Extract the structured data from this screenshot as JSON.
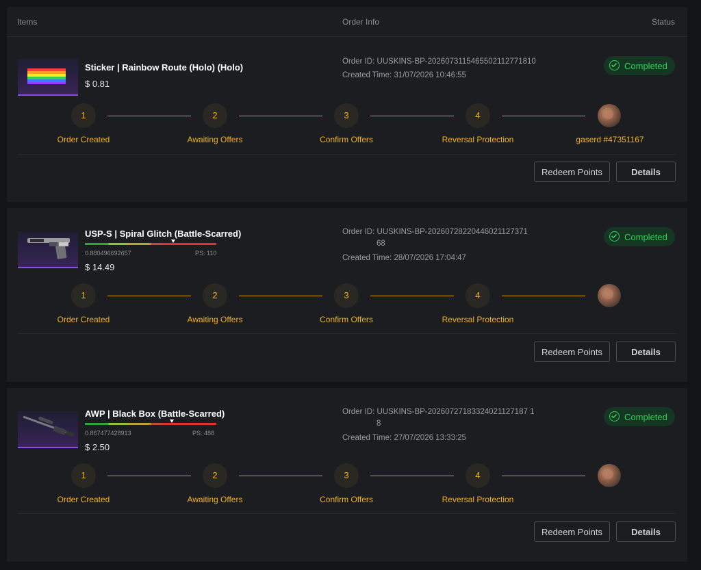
{
  "header": {
    "items": "Items",
    "order_info": "Order Info",
    "status": "Status"
  },
  "labels": {
    "order_id_prefix": "Order ID:",
    "created_prefix": "Created Time:",
    "redeem": "Redeem Points",
    "details": "Details"
  },
  "steps": [
    {
      "num": "1",
      "label": "Order Created"
    },
    {
      "num": "2",
      "label": "Awaiting Offers"
    },
    {
      "num": "3",
      "label": "Confirm Offers"
    },
    {
      "num": "4",
      "label": "Reversal Protection"
    }
  ],
  "orders": [
    {
      "name": "Sticker | Rainbow Route (Holo) (Holo)",
      "price": "$ 0.81",
      "order_id": "UUSKINS-BP-20260731154655021127718​10",
      "order_id_line1": "UUSKINS-BP-2026073115465502112771810",
      "created": "31/07/2026 10:46:55",
      "status": "Completed",
      "user": "gaserd #47351167",
      "thumb_icon": "sticker-rainbow-icon"
    },
    {
      "name": "USP-S | Spiral Glitch (Battle-Scarred)",
      "price": "$ 14.49",
      "float": "0.880496692657",
      "ps": "PS: 110",
      "wear_fraction": 0.67,
      "order_id_line1": "UUSKINS-BP-202607282204460211273​71",
      "order_id_l1": "UUSKINS-BP-2026072822044602112737 1",
      "order_id_a": "UUSKINS-BP-202607282204460211273​71",
      "order_id_first": "UUSKINS-BP-20260728220446021127371",
      "order_id_second": "68",
      "created": "28/07/2026 17:04:47",
      "status": "Completed",
      "thumb_icon": "pistol-icon"
    },
    {
      "name": "AWP | Black Box (Battle-Scarred)",
      "price": "$ 2.50",
      "float": "0.867477428913",
      "ps": "PS: 488",
      "wear_fraction": 0.67,
      "order_id_first": "UUSKINS-BP-20260727183324021127187 1",
      "order_id_second": "8",
      "created": "27/07/2026 13:33:25",
      "status": "Completed",
      "thumb_icon": "sniper-rifle-icon"
    }
  ]
}
